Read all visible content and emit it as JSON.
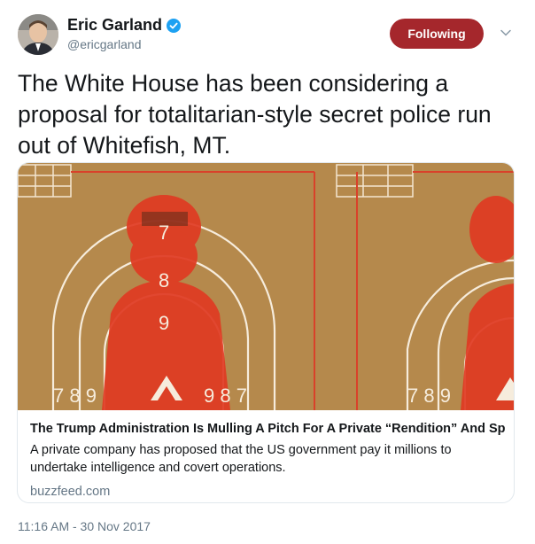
{
  "author": {
    "display_name": "Eric Garland",
    "handle": "@ericgarland",
    "verified": true,
    "avatar_icon": "profile-photo"
  },
  "follow_button": {
    "label": "Following",
    "color": "#a5272c"
  },
  "tweet": {
    "text": "The White House has been considering a proposal for totalitarian-style secret police run out of Whitefish, MT."
  },
  "card": {
    "image_icon": "shooting-target-illustration",
    "title": "The Trump Administration Is Mulling A Pitch For A Private “Rendition” And Sp...",
    "description": "A private company has proposed that the US government pay it millions to undertake intelligence and covert operations.",
    "domain": "buzzfeed.com"
  },
  "timestamp": "11:16 AM - 30 Nov 2017",
  "colors": {
    "accent": "#1da1f2",
    "muted": "#657786",
    "image_bg": "#b5894c",
    "image_red": "#e03a22"
  }
}
